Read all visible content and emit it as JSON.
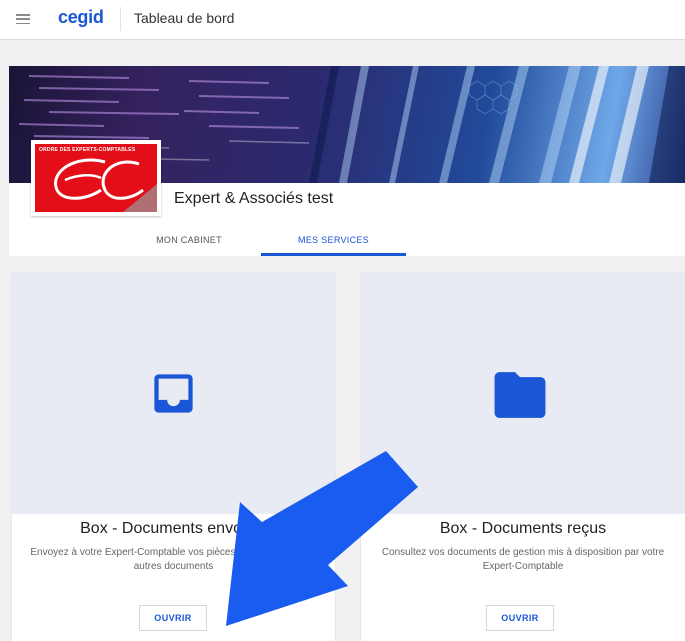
{
  "app": {
    "brand": "cegid",
    "page_title": "Tableau de bord",
    "menu_icon": "hamburger-menu-icon"
  },
  "profile": {
    "logo_caption": "ORDRE DES EXPERTS-COMPTABLES",
    "logo_letters": "ec",
    "cabinet_name": "Expert & Associés test",
    "tabs": [
      {
        "label": "MON CABINET",
        "active": false
      },
      {
        "label": "MES SERVICES",
        "active": true
      }
    ]
  },
  "services": [
    {
      "title": "Box - Documents envoyés",
      "description": "Envoyez à votre Expert-Comptable vos pièces à comptabiliser et autres documents",
      "button": "OUVRIR",
      "icon": "inbox-icon"
    },
    {
      "title": "Box - Documents reçus",
      "description": "Consultez vos documents de gestion mis à disposition par votre Expert-Comptable",
      "button": "OUVRIR",
      "icon": "folder-icon"
    }
  ],
  "colors": {
    "accent": "#1b56d6",
    "logo_red": "#e30e18",
    "card_media_bg": "#e8ebf4",
    "annotation_arrow": "#1b5cf0"
  }
}
